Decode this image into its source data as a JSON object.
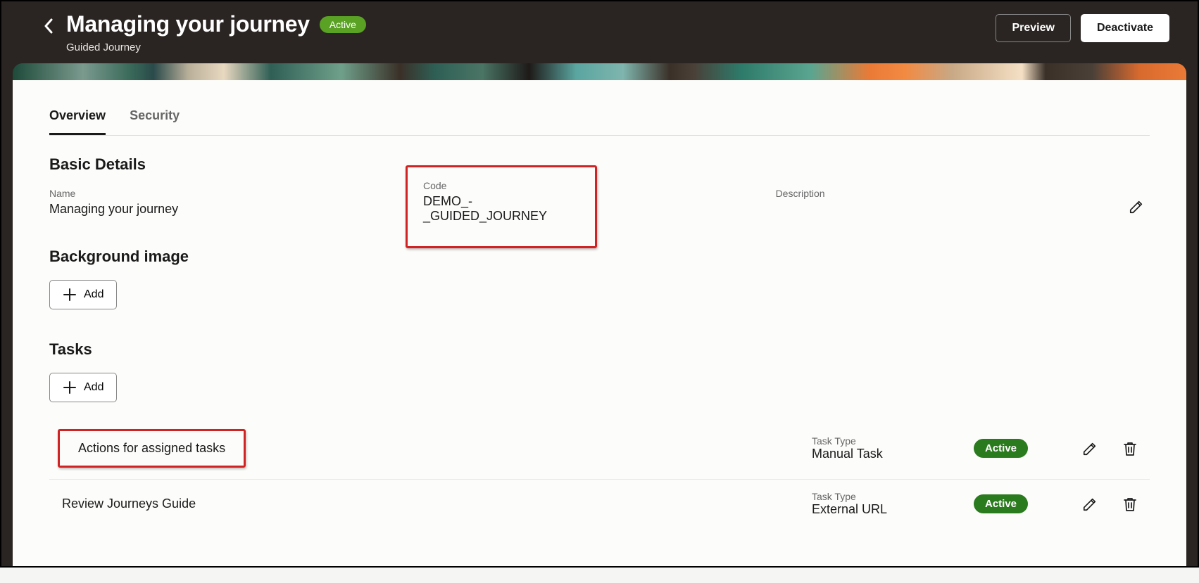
{
  "header": {
    "title": "Managing your journey",
    "status": "Active",
    "subtitle": "Guided Journey",
    "preview_btn": "Preview",
    "deactivate_btn": "Deactivate"
  },
  "tabs": [
    {
      "label": "Overview",
      "active": true
    },
    {
      "label": "Security",
      "active": false
    }
  ],
  "basic_details": {
    "heading": "Basic Details",
    "name_label": "Name",
    "name_value": "Managing your journey",
    "code_label": "Code",
    "code_value": "DEMO_-_GUIDED_JOURNEY",
    "description_label": "Description"
  },
  "background_image": {
    "heading": "Background image",
    "add_label": "Add"
  },
  "tasks_section": {
    "heading": "Tasks",
    "add_label": "Add",
    "type_label": "Task Type",
    "tasks": [
      {
        "name": "Actions for assigned tasks",
        "type": "Manual Task",
        "status": "Active",
        "highlighted": true
      },
      {
        "name": "Review Journeys Guide",
        "type": "External URL",
        "status": "Active",
        "highlighted": false
      }
    ]
  }
}
